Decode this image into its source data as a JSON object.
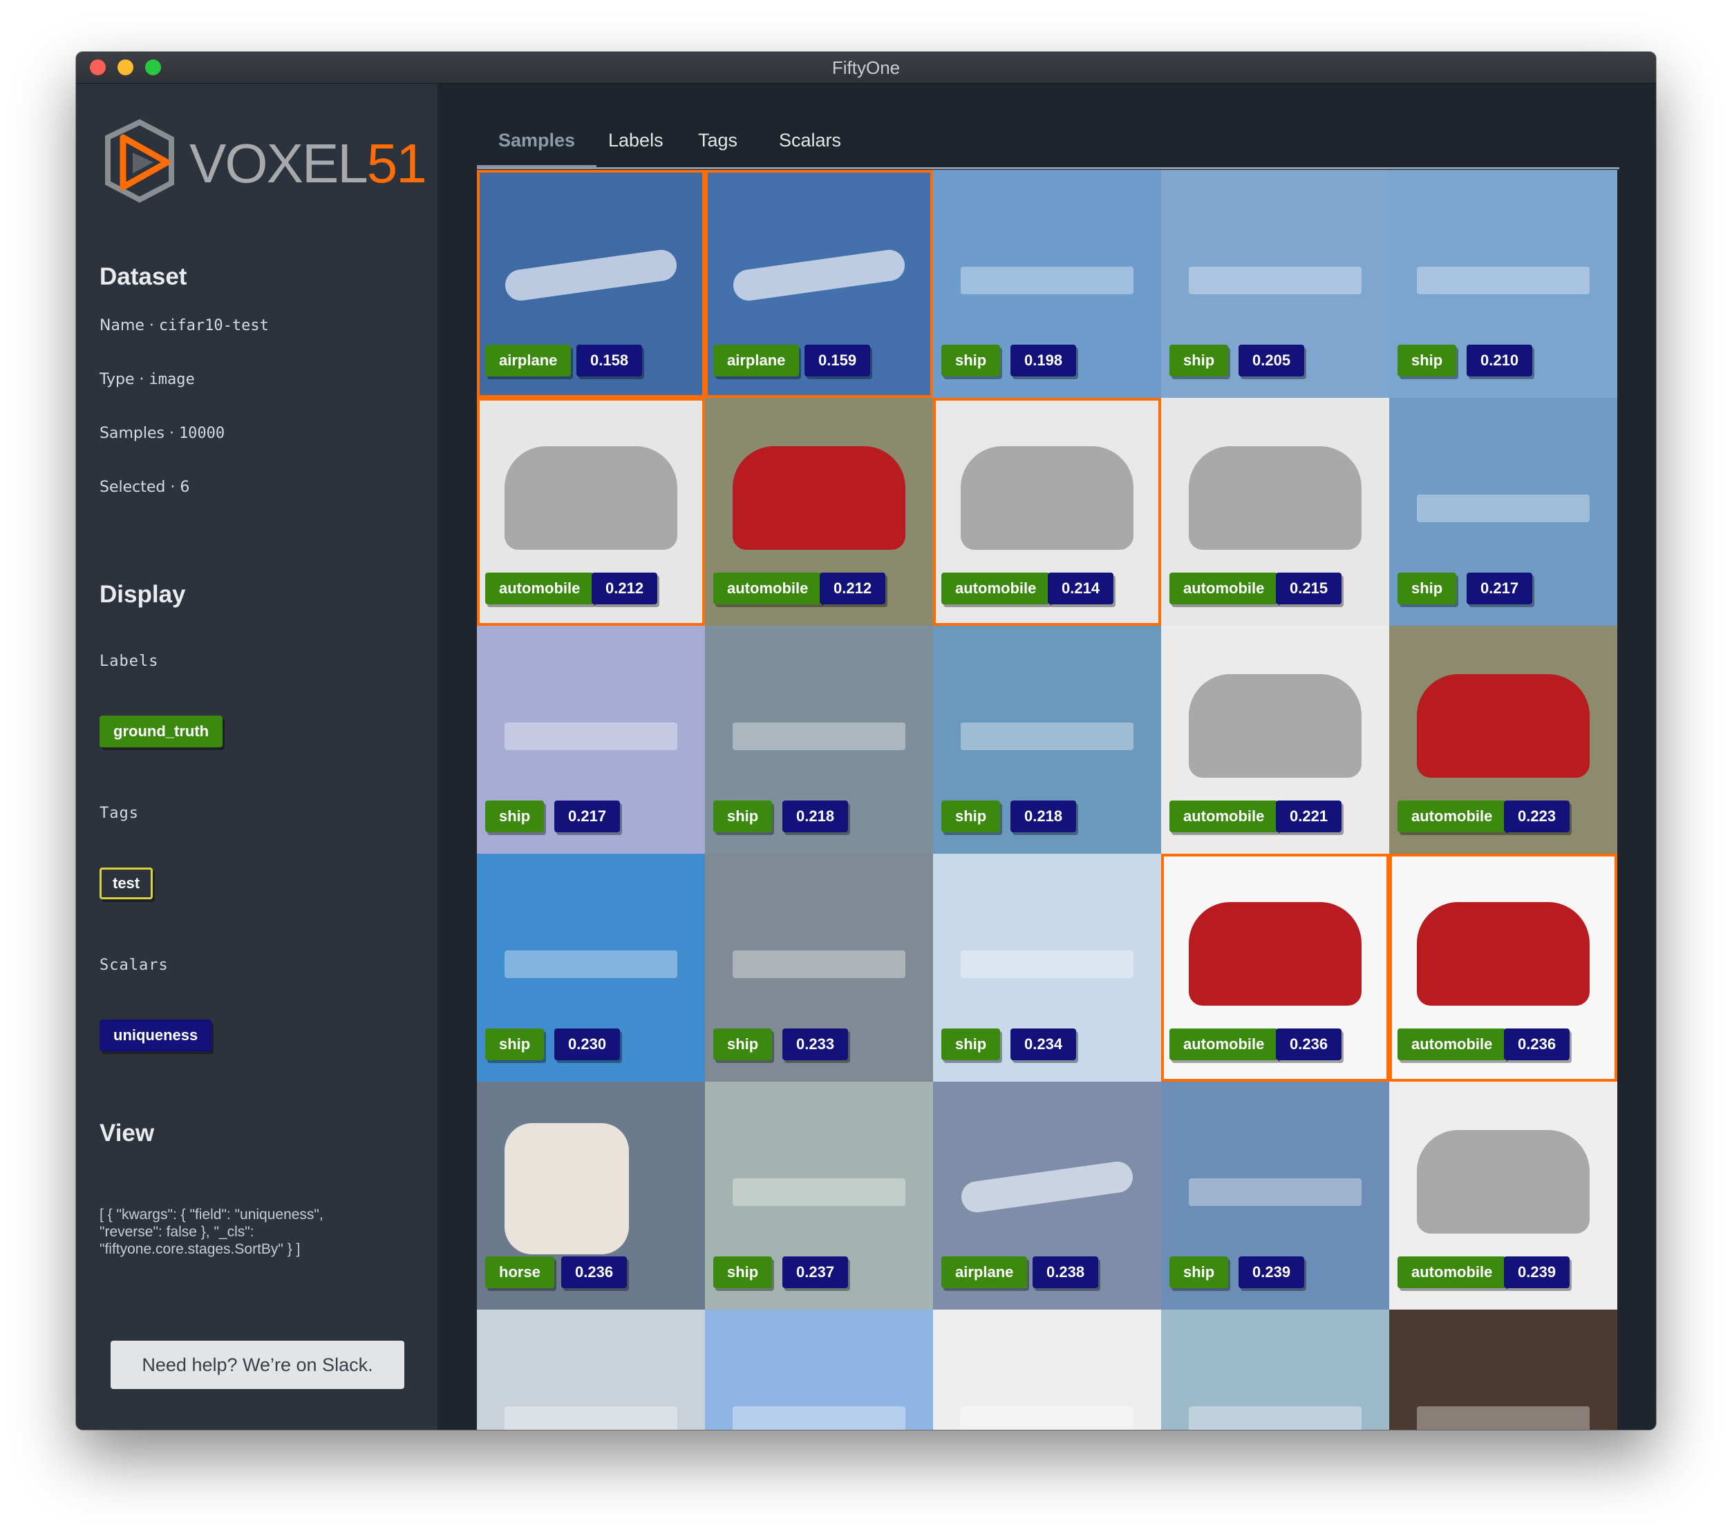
{
  "window": {
    "title": "FiftyOne"
  },
  "logo": {
    "text": "VOXEL",
    "number": "51"
  },
  "dataset": {
    "heading": "Dataset",
    "name_key": "Name",
    "name_value": "cifar10-test",
    "type_key": "Type",
    "type_value": "image",
    "samples_key": "Samples",
    "samples_value": "10000",
    "selected_key": "Selected",
    "selected_value": "6"
  },
  "display": {
    "heading": "Display",
    "labels_heading": "Labels",
    "label_chip": "ground_truth",
    "tags_heading": "Tags",
    "tag_chip": "test",
    "scalars_heading": "Scalars",
    "scalar_chip": "uniqueness"
  },
  "view": {
    "heading": "View",
    "text": "[ { \"kwargs\": { \"field\": \"uniqueness\", \"reverse\": false }, \"_cls\": \"fiftyone.core.stages.SortBy\" } ]"
  },
  "help_button": "Need help? We’re on Slack.",
  "tabs": [
    "Samples",
    "Labels",
    "Tags",
    "Scalars"
  ],
  "active_tab": "Samples",
  "colors": {
    "accent": "#ff6d04",
    "label_green": "#3b8a0f",
    "score_navy": "#13117a",
    "tag_yellow": "#d9d33a"
  },
  "samples": [
    {
      "label": "airplane",
      "score": "0.158",
      "selected": true,
      "bg": "#3f6aa3"
    },
    {
      "label": "airplane",
      "score": "0.159",
      "selected": true,
      "bg": "#4471ab"
    },
    {
      "label": "ship",
      "score": "0.198",
      "selected": false,
      "bg": "#6e9ccb"
    },
    {
      "label": "ship",
      "score": "0.205",
      "selected": false,
      "bg": "#7fa6cf"
    },
    {
      "label": "ship",
      "score": "0.210",
      "selected": false,
      "bg": "#7aa5cf"
    },
    {
      "label": "automobile",
      "score": "0.212",
      "selected": true,
      "bg": "#e6e6e6"
    },
    {
      "label": "automobile",
      "score": "0.212",
      "selected": false,
      "bg": "#8a8a6c"
    },
    {
      "label": "automobile",
      "score": "0.214",
      "selected": true,
      "bg": "#e8e8e8"
    },
    {
      "label": "automobile",
      "score": "0.215",
      "selected": false,
      "bg": "#e7e7e7"
    },
    {
      "label": "ship",
      "score": "0.217",
      "selected": false,
      "bg": "#6f9bc4"
    },
    {
      "label": "ship",
      "score": "0.217",
      "selected": false,
      "bg": "#a8acd4"
    },
    {
      "label": "ship",
      "score": "0.218",
      "selected": false,
      "bg": "#7e8f9c"
    },
    {
      "label": "ship",
      "score": "0.218",
      "selected": false,
      "bg": "#6b99bd"
    },
    {
      "label": "automobile",
      "score": "0.221",
      "selected": false,
      "bg": "#ebebeb"
    },
    {
      "label": "automobile",
      "score": "0.223",
      "selected": false,
      "bg": "#8d8b6d"
    },
    {
      "label": "ship",
      "score": "0.230",
      "selected": false,
      "bg": "#3f8cce"
    },
    {
      "label": "ship",
      "score": "0.233",
      "selected": false,
      "bg": "#808a94"
    },
    {
      "label": "ship",
      "score": "0.234",
      "selected": false,
      "bg": "#c8d9eb"
    },
    {
      "label": "automobile",
      "score": "0.236",
      "selected": true,
      "bg": "#f7f7f7"
    },
    {
      "label": "automobile",
      "score": "0.236",
      "selected": true,
      "bg": "#f7f7f7"
    },
    {
      "label": "horse",
      "score": "0.236",
      "selected": false,
      "bg": "#6c7a8e"
    },
    {
      "label": "ship",
      "score": "0.237",
      "selected": false,
      "bg": "#a3b4b0"
    },
    {
      "label": "airplane",
      "score": "0.238",
      "selected": false,
      "bg": "#7e8da8"
    },
    {
      "label": "ship",
      "score": "0.239",
      "selected": false,
      "bg": "#6c8db6"
    },
    {
      "label": "automobile",
      "score": "0.239",
      "selected": false,
      "bg": "#eeeeee"
    },
    {
      "label": "",
      "score": "",
      "selected": false,
      "bg": "#c9d1d9"
    },
    {
      "label": "",
      "score": "",
      "selected": false,
      "bg": "#8fb5e4"
    },
    {
      "label": "",
      "score": "",
      "selected": false,
      "bg": "#eeeeee"
    },
    {
      "label": "",
      "score": "",
      "selected": false,
      "bg": "#9bb9c9"
    },
    {
      "label": "",
      "score": "",
      "selected": false,
      "bg": "#4a3a30"
    }
  ]
}
